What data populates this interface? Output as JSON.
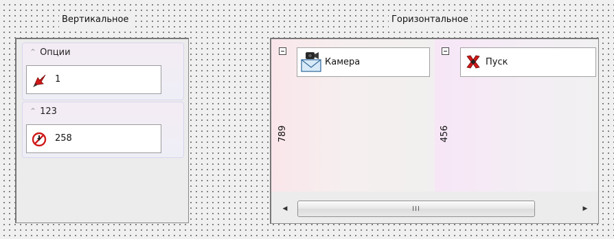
{
  "groups": {
    "vertical_title": "Вертикальное",
    "horizontal_title": "Горизонтальное"
  },
  "vertical": {
    "sections": [
      {
        "header": "Опции",
        "expanded": true,
        "item": {
          "label": "1",
          "icon": "red-arrow-icon"
        }
      },
      {
        "header": "123",
        "expanded": true,
        "item": {
          "label": "258",
          "icon": "no-entry-icon"
        }
      }
    ]
  },
  "horizontal": {
    "columns": [
      {
        "caption": "789",
        "collapse_icon": "minus-box-icon",
        "item": {
          "label": "Камера",
          "icon": "camera-mail-icon"
        }
      },
      {
        "caption": "456",
        "collapse_icon": "minus-box-icon",
        "item": {
          "label": "Пуск",
          "icon": "red-x-icon"
        }
      }
    ],
    "scrollbar": {
      "left_arrow": "scroll-left-arrow-icon",
      "right_arrow": "scroll-right-arrow-icon",
      "grip": "III"
    }
  },
  "colors": {
    "background": "#f0f0f0",
    "vertical_section_bg": "#f3edf5",
    "horizontal_col1_bg": "#f8ecee",
    "horizontal_col2_bg": "#f5ecf5",
    "accent_red": "#cc1111"
  }
}
